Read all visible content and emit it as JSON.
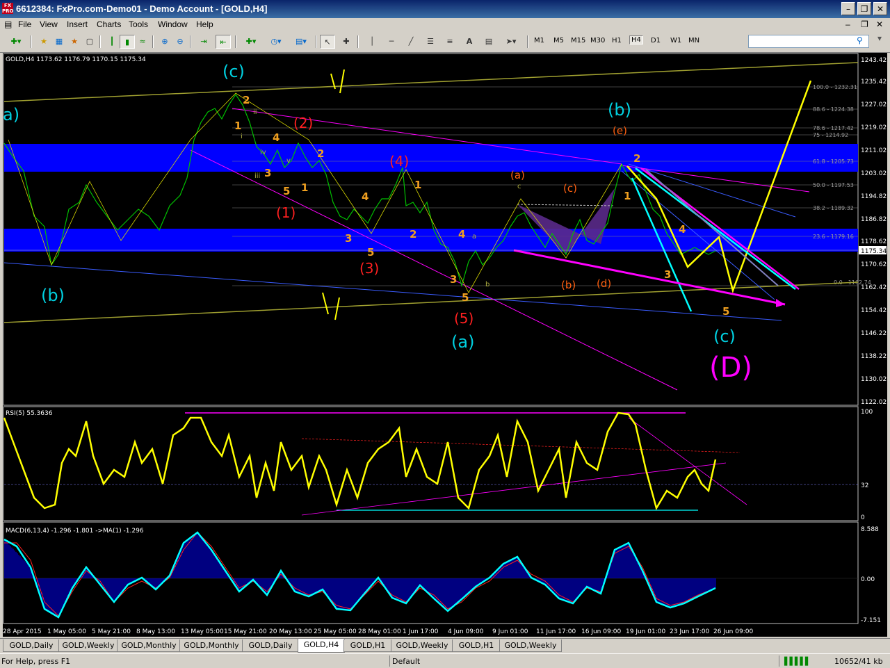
{
  "window": {
    "title": "6612384: FxPro.com-Demo01 - Demo Account - [GOLD,H4]",
    "logo_text": "FX PRO"
  },
  "menu": [
    "File",
    "View",
    "Insert",
    "Charts",
    "Tools",
    "Window",
    "Help"
  ],
  "timeframes": [
    "M1",
    "M5",
    "M15",
    "M30",
    "H1",
    "H4",
    "D1",
    "W1",
    "MN"
  ],
  "active_timeframe": "H4",
  "search": {
    "placeholder": ""
  },
  "chart": {
    "symbol_info": "GOLD,H4  1173.62 1176.79 1170.15 1175.34",
    "current_price": "1175.34",
    "price_axis": [
      "1243.42",
      "1235.42",
      "1227.02",
      "1219.02",
      "1211.02",
      "1203.02",
      "1194.82",
      "1186.82",
      "1178.62",
      "1170.62",
      "1162.42",
      "1154.42",
      "1146.22",
      "1138.22",
      "1130.02",
      "1122.02"
    ],
    "fib_levels": [
      "100.0 - 1232.31",
      "88.6 - 1224.38",
      "78.6 - 1217.42",
      "75 - 1214.92",
      "61.8 - 1205.73",
      "50.0 - 1197.53",
      "38.2 - 1189.32",
      "23.6 - 1179.16",
      "0.0 - 1162.74"
    ],
    "wave_labels": {
      "a_left": "a)",
      "b_left": "(b)",
      "c_top": "(c)",
      "two_red": "(2)",
      "one_red": "(1)",
      "three_red": "(3)",
      "four_red": "(4)",
      "five_red": "(5)",
      "a_cyan": "(a)",
      "a_orange": "(a)",
      "c_orange": "(c)",
      "b_orange": "(b)",
      "d_orange": "(d)",
      "e_orange": "(e)",
      "b_cyan": "(b)",
      "c_cyan": "(c)",
      "D_magenta": "(D)"
    },
    "small_labels": [
      "2",
      "1",
      "4",
      "3",
      "5",
      "1",
      "2",
      "4",
      "3",
      "5",
      "2",
      "1",
      "4",
      "3",
      "5",
      "2",
      "1",
      "4",
      "3",
      "5",
      "i",
      "ii",
      "iii",
      "iv",
      "v",
      "a",
      "b",
      "c"
    ],
    "time_axis": [
      "28 Apr 2015",
      "1 May 05:00",
      "5 May 21:00",
      "8 May 13:00",
      "13 May 05:00",
      "15 May 21:00",
      "20 May 13:00",
      "25 May 05:00",
      "28 May 01:00",
      "1 Jun 17:00",
      "4 Jun 09:00",
      "9 Jun 01:00",
      "11 Jun 17:00",
      "16 Jun 09:00",
      "19 Jun 01:00",
      "23 Jun 17:00",
      "26 Jun 09:00"
    ]
  },
  "rsi": {
    "title": "RSI(5) 55.3636",
    "axis": [
      "100",
      "32",
      "0"
    ]
  },
  "macd": {
    "title": "MACD(6,13,4) -1.296 -1.801 ->MA(1) -1.296",
    "axis": [
      "8.588",
      "0.00",
      "-7.151"
    ]
  },
  "tabs": [
    "GOLD,Daily",
    "GOLD,Weekly",
    "GOLD,Monthly",
    "GOLD,Monthly",
    "GOLD,Daily",
    "GOLD,H4",
    "GOLD,H1",
    "GOLD,Weekly",
    "GOLD,H1",
    "GOLD,Weekly"
  ],
  "active_tab": "GOLD,H4",
  "status": {
    "help": "For Help, press F1",
    "profile": "Default",
    "traffic": "10652/41 kb"
  },
  "colors": {
    "background": "#000000",
    "price_line": "#00c000",
    "rsi": "#ffff00",
    "macd_hist": "#0000ff",
    "macd_line": "#00ffff",
    "signal": "#ff0000",
    "zone": "#0000ff",
    "magenta": "#ff00ff",
    "cyan": "#00ffff",
    "orange": "#ffa500",
    "red": "#ff0000"
  },
  "icons": [
    "new-chart-icon",
    "profiles-icon",
    "market-watch-icon",
    "navigator-icon",
    "terminal-icon",
    "zoom-in-icon",
    "zoom-out-icon",
    "tile-icon",
    "autoscroll-icon",
    "chart-shift-icon",
    "indicators-icon",
    "periods-icon",
    "templates-icon",
    "cursor-icon",
    "crosshair-icon",
    "vertical-line-icon",
    "horizontal-line-icon",
    "trendline-icon",
    "channel-icon",
    "fibonacci-icon",
    "text-icon",
    "label-icon",
    "arrows-icon",
    "search-icon"
  ]
}
